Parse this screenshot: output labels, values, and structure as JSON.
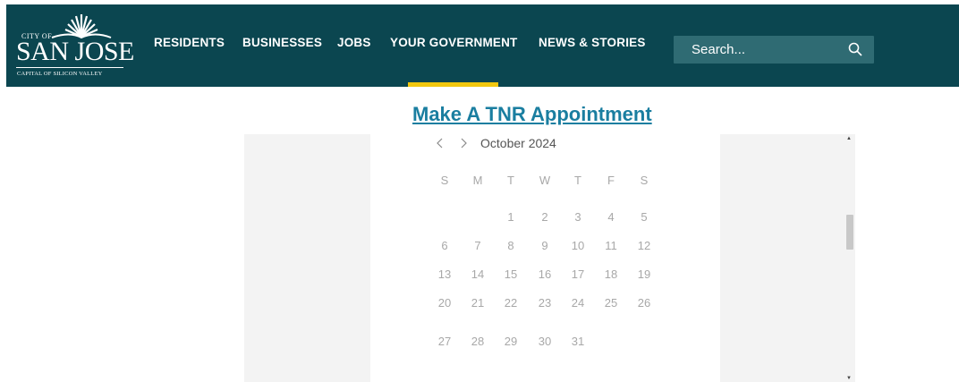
{
  "header": {
    "logo": {
      "city_of": "CITY OF",
      "name": "SAN JOSE",
      "tagline": "CAPITAL OF SILICON VALLEY"
    },
    "nav": [
      "RESIDENTS",
      "BUSINESSES",
      "JOBS",
      "YOUR GOVERNMENT",
      "NEWS & STORIES"
    ],
    "active_nav": "YOUR GOVERNMENT",
    "search": {
      "placeholder": "Search..."
    },
    "colors": {
      "header_bg": "#0b4650",
      "search_bg": "#2f6b73",
      "active_underline": "#f2c70e"
    }
  },
  "main": {
    "title": "Make A TNR Appointment",
    "title_color": "#1a7ea0"
  },
  "calendar": {
    "month_label": "October 2024",
    "weekdays": [
      "S",
      "M",
      "T",
      "W",
      "T",
      "F",
      "S"
    ],
    "weeks": [
      [
        "",
        "",
        "1",
        "2",
        "3",
        "4",
        "5"
      ],
      [
        "6",
        "7",
        "8",
        "9",
        "10",
        "11",
        "12"
      ],
      [
        "13",
        "14",
        "15",
        "16",
        "17",
        "18",
        "19"
      ],
      [
        "20",
        "21",
        "22",
        "23",
        "24",
        "25",
        "26"
      ],
      [
        "27",
        "28",
        "29",
        "30",
        "31",
        "",
        ""
      ]
    ],
    "icons": {
      "prev": "chevron-left-icon",
      "next": "chevron-right-icon"
    }
  }
}
